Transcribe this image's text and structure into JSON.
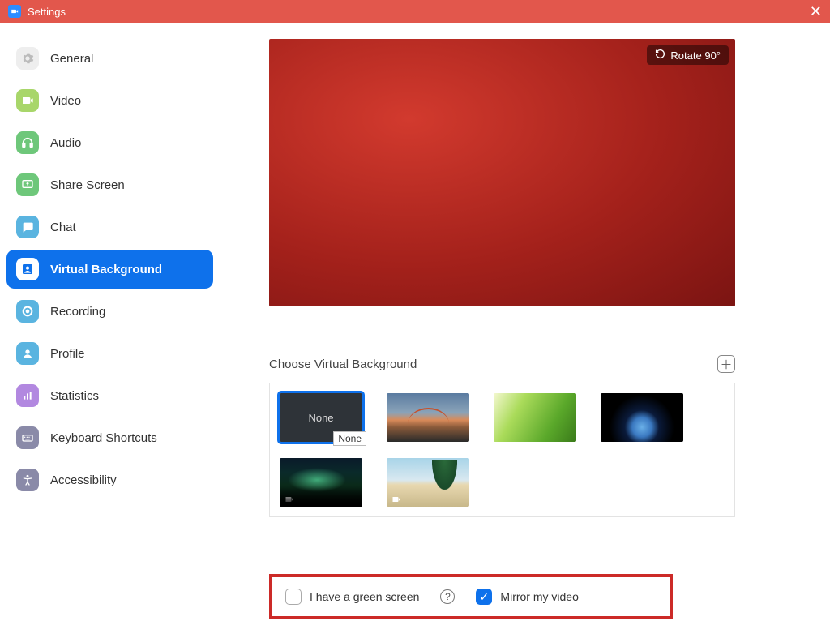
{
  "window": {
    "title": "Settings"
  },
  "sidebar": {
    "items": [
      {
        "label": "General"
      },
      {
        "label": "Video"
      },
      {
        "label": "Audio"
      },
      {
        "label": "Share Screen"
      },
      {
        "label": "Chat"
      },
      {
        "label": "Virtual Background"
      },
      {
        "label": "Recording"
      },
      {
        "label": "Profile"
      },
      {
        "label": "Statistics"
      },
      {
        "label": "Keyboard Shortcuts"
      },
      {
        "label": "Accessibility"
      }
    ]
  },
  "main": {
    "rotate_label": "Rotate 90°",
    "section_title": "Choose Virtual Background",
    "none_label": "None",
    "tooltip_none": "None",
    "green_screen_label": "I have a green screen",
    "mirror_label": "Mirror my video"
  }
}
